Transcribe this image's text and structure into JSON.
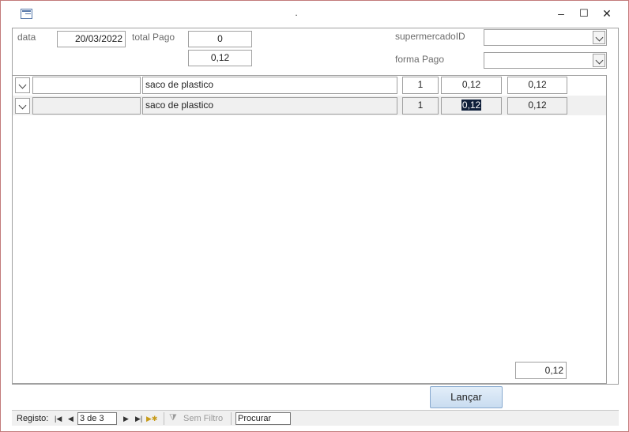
{
  "window": {
    "title": "."
  },
  "titlebar": {
    "minimize": "–",
    "maximize": "☐",
    "close": "✕"
  },
  "form": {
    "data_label": "data",
    "data_value": "20/03/2022",
    "total_pago_label": "total Pago",
    "total_pago_value": "0",
    "total_calc_value": "0,12",
    "supermercado_label": "supermercadoID",
    "supermercado_value": "",
    "forma_pago_label": "forma Pago",
    "forma_pago_value": ""
  },
  "items": [
    {
      "produto": "",
      "descricao": "saco de plastico",
      "quantidade": "1",
      "preco": "0,12",
      "total": "0,12"
    },
    {
      "produto": "",
      "descricao": "saco de plastico",
      "quantidade": "1",
      "preco": "0,12",
      "total": "0,12"
    }
  ],
  "subform_total": "0,12",
  "lancar_label": "Lançar",
  "navigation": {
    "registo_label": "Registo:",
    "record_value": "3 de 3",
    "filter_label": "Sem Filtro",
    "search_value": "Procurar"
  },
  "icons": [
    "form-icon",
    "chevron-down-icon",
    "first-record-icon",
    "previous-record-icon",
    "next-record-icon",
    "last-record-icon",
    "new-record-icon",
    "filter-icon"
  ]
}
